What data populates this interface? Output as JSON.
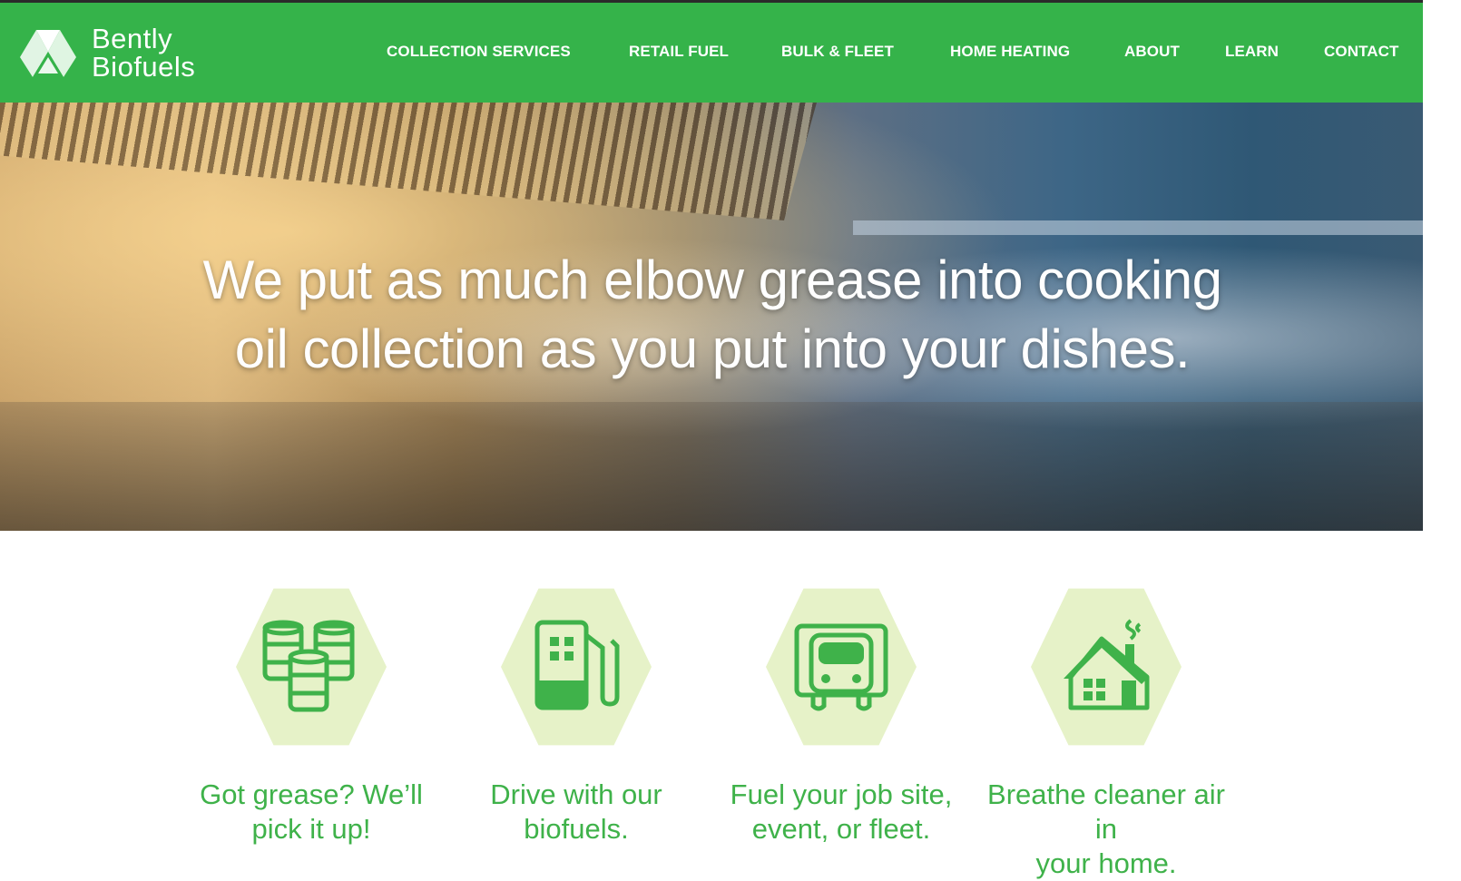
{
  "brand": {
    "line1": "Bently",
    "line2": "Biofuels"
  },
  "nav": {
    "items": [
      {
        "label": "COLLECTION SERVICES"
      },
      {
        "label": "RETAIL FUEL"
      },
      {
        "label": "BULK & FLEET"
      },
      {
        "label": "HOME HEATING"
      },
      {
        "label": "ABOUT"
      },
      {
        "label": "LEARN"
      },
      {
        "label": "CONTACT"
      }
    ]
  },
  "hero": {
    "headline_line1": "We put as much elbow grease into cooking",
    "headline_line2": "oil collection as you put into your dishes."
  },
  "features": [
    {
      "icon": "barrels-icon",
      "line1": "Got grease? We’ll",
      "line2": "pick it up!"
    },
    {
      "icon": "fuel-pump-icon",
      "line1": "Drive with our",
      "line2": "biofuels."
    },
    {
      "icon": "truck-icon",
      "line1": "Fuel your job site,",
      "line2": "event, or fleet."
    },
    {
      "icon": "house-icon",
      "line1": "Breathe cleaner air in",
      "line2": "your home."
    }
  ],
  "colors": {
    "brand_green": "#35b34a",
    "icon_green": "#3fb24a",
    "hex_bg": "#e6f2c8"
  }
}
